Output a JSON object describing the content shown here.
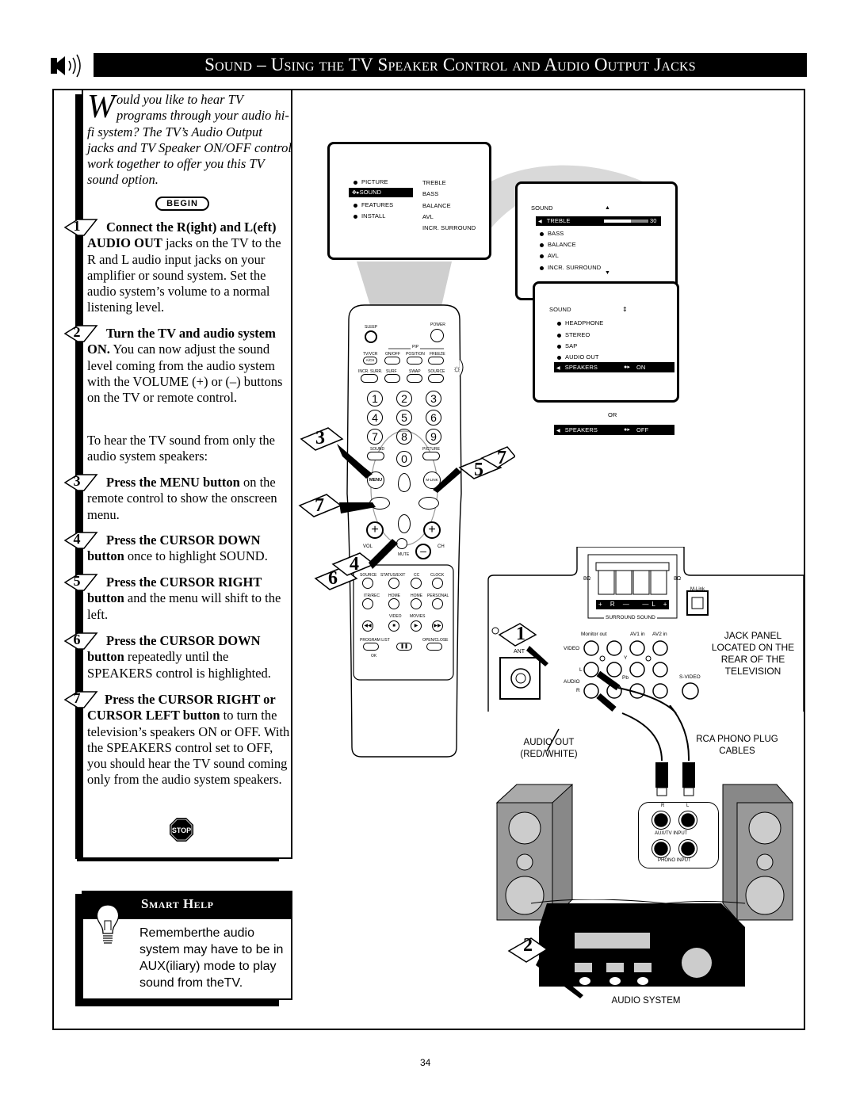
{
  "header": {
    "title": "Sound – Using the TV Speaker Control and Audio Output Jacks",
    "icon": "speaker-icon"
  },
  "intro": {
    "dropcap": "W",
    "text": "ould you like to hear TV programs through your audio hi-fi system?  The TV’s Audio Output jacks and TV Speaker ON/OFF control work together to offer you this TV sound option."
  },
  "begin_label": "BEGIN",
  "steps": [
    {
      "num": "1",
      "bold": "Connect the R(ight) and L(eft) AUDIO OUT",
      "text": " jacks on the TV to the R and L audio input jacks on your amplifier or sound system.  Set the audio system’s volume to a normal listening level."
    },
    {
      "num": "2",
      "bold": "Turn the TV and audio system ON.",
      "text": "  You can now adjust the sound level coming from the audio system with the VOLUME (+) or (–) buttons on the TV or remote control."
    },
    {
      "num": "3",
      "bold": "Press the MENU button",
      "text": " on the remote control to show the onscreen menu."
    },
    {
      "num": "4",
      "bold": "Press the CURSOR DOWN button",
      "text": " once to highlight SOUND."
    },
    {
      "num": "5",
      "bold": "Press the CURSOR RIGHT button",
      "text": " and the menu will shift to the left."
    },
    {
      "num": "6",
      "bold": "Press the CURSOR DOWN button",
      "text": " repeatedly until the SPEAKERS control is highlighted."
    },
    {
      "num": "7",
      "bold": "Press the CURSOR RIGHT or CURSOR LEFT button",
      "text": " to turn the television’s speakers ON or OFF. With the SPEAKERS control set to OFF, you should hear the TV sound coming only from the audio system speakers."
    }
  ],
  "interlude": "To hear the TV sound from only the audio system speakers:",
  "stop_label": "STOP",
  "smart_help": {
    "title": "Smart Help",
    "text": "Rememberthe audio system may have to be in AUX(iliary) mode to play sound from theTV."
  },
  "menu_main": {
    "left_items": [
      "PICTURE",
      "SOUND",
      "FEATURES",
      "INSTALL"
    ],
    "selected": "SOUND",
    "right_items": [
      "TREBLE",
      "BASS",
      "BALANCE",
      "AVL",
      "INCR. SURROUND"
    ]
  },
  "menu_sound1": {
    "title": "SOUND",
    "items": [
      "TREBLE",
      "BASS",
      "BALANCE",
      "AVL",
      "INCR. SURROUND"
    ],
    "selected": "TREBLE",
    "treble_value": "30",
    "treble_fraction": 0.6
  },
  "menu_sound2": {
    "title": "SOUND",
    "items": [
      "HEADPHONE",
      "STEREO",
      "SAP",
      "AUDIO OUT"
    ],
    "selected_label": "SPEAKERS",
    "selected_value": "ON"
  },
  "or_label": "OR",
  "speakers_off": {
    "label": "SPEAKERS",
    "value": "OFF"
  },
  "remote": {
    "sleep": "SLEEP",
    "power": "POWER",
    "pip": "PIP",
    "row1": [
      "TV/VCR",
      "ON/OFF",
      "POSITION",
      "FREEZE"
    ],
    "tvvcr_sub": "A/CH",
    "row2": [
      "INCR. SURR.",
      "SURF",
      "SWAP",
      "SOURCE"
    ],
    "digits": [
      "1",
      "2",
      "3",
      "4",
      "5",
      "6",
      "7",
      "8",
      "9",
      "0"
    ],
    "sound": "SOUND",
    "picture": "PICTURE",
    "menu": "MENU",
    "mlink": "M-LINK",
    "vol": "VOL",
    "ch": "CH",
    "mute": "MUTE",
    "row3": [
      "SOURCE",
      "STATUS/EXIT",
      "CC",
      "CLOCK"
    ],
    "row4": [
      "ITR/REC",
      "HOME",
      "HOME",
      "PERSONAL"
    ],
    "video": "VIDEO",
    "movies": "MOVIES",
    "program_list": "PROGRAM LIST",
    "open_close": "OPEN/CLOSE",
    "ok": "OK"
  },
  "callouts": [
    "3",
    "7",
    "4",
    "6",
    "5",
    "7",
    "1",
    "2"
  ],
  "jack_panel": {
    "ohm_left": "8Ω",
    "ohm_right": "8Ω",
    "terminal_labels": [
      "+",
      "R",
      "—",
      "—",
      "L",
      "+"
    ],
    "surround": "SURROUND SOUND",
    "mlink": "M-Link",
    "monitor_out": "Monitor out",
    "av1": "AV1 in",
    "av2": "AV2 in",
    "video": "VIDEO",
    "y": "Y",
    "l": "L",
    "pb": "Pb",
    "audio": "AUDIO",
    "r": "R",
    "svideo": "S-VIDEO",
    "ant": "ANT",
    "caption": "JACK PANEL LOCATED ON THE REAR OF THE TELEVISION"
  },
  "audio_out_label": "AUDIO OUT (RED/WHITE)",
  "rca_label": "RCA PHONO PLUG CABLES",
  "receiver_panel": {
    "r": "R",
    "l": "L",
    "aux": "AUX/TV INPUT",
    "phono": "PHONO INPUT"
  },
  "audio_system_label": "AUDIO SYSTEM",
  "page_number": "34"
}
